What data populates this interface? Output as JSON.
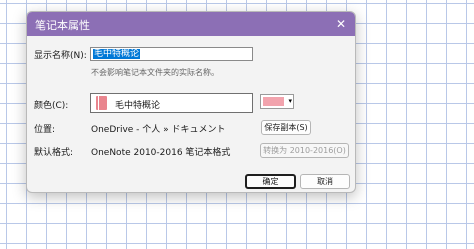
{
  "dialog": {
    "title": "笔记本属性",
    "close_glyph": "✕",
    "display_name": {
      "label": "显示名称(N):",
      "value": "毛中特概论",
      "hint": "不会影响笔记本文件夹的实际名称。"
    },
    "color": {
      "label": "颜色(C):",
      "notebook_name": "毛中特概论",
      "swatch_color": "#f2a3ad",
      "icon": "notebook-icon",
      "dropdown_glyph": "▾"
    },
    "location": {
      "label": "位置:",
      "value": "OneDrive - 个人 » ドキュメント",
      "button": "保存副本(S)"
    },
    "format": {
      "label": "默认格式:",
      "value": "OneNote 2010-2016 笔记本格式",
      "button": "转换为 2010-2016(O)"
    },
    "ok_button": "确定",
    "cancel_button": "取消"
  },
  "colors": {
    "titlebar": "#8c6fb5",
    "dialog_bg": "#f3f3f3",
    "selection": "#0078d7",
    "notebook_icon": "#e9858e",
    "grid_line": "#b9c8e8"
  }
}
